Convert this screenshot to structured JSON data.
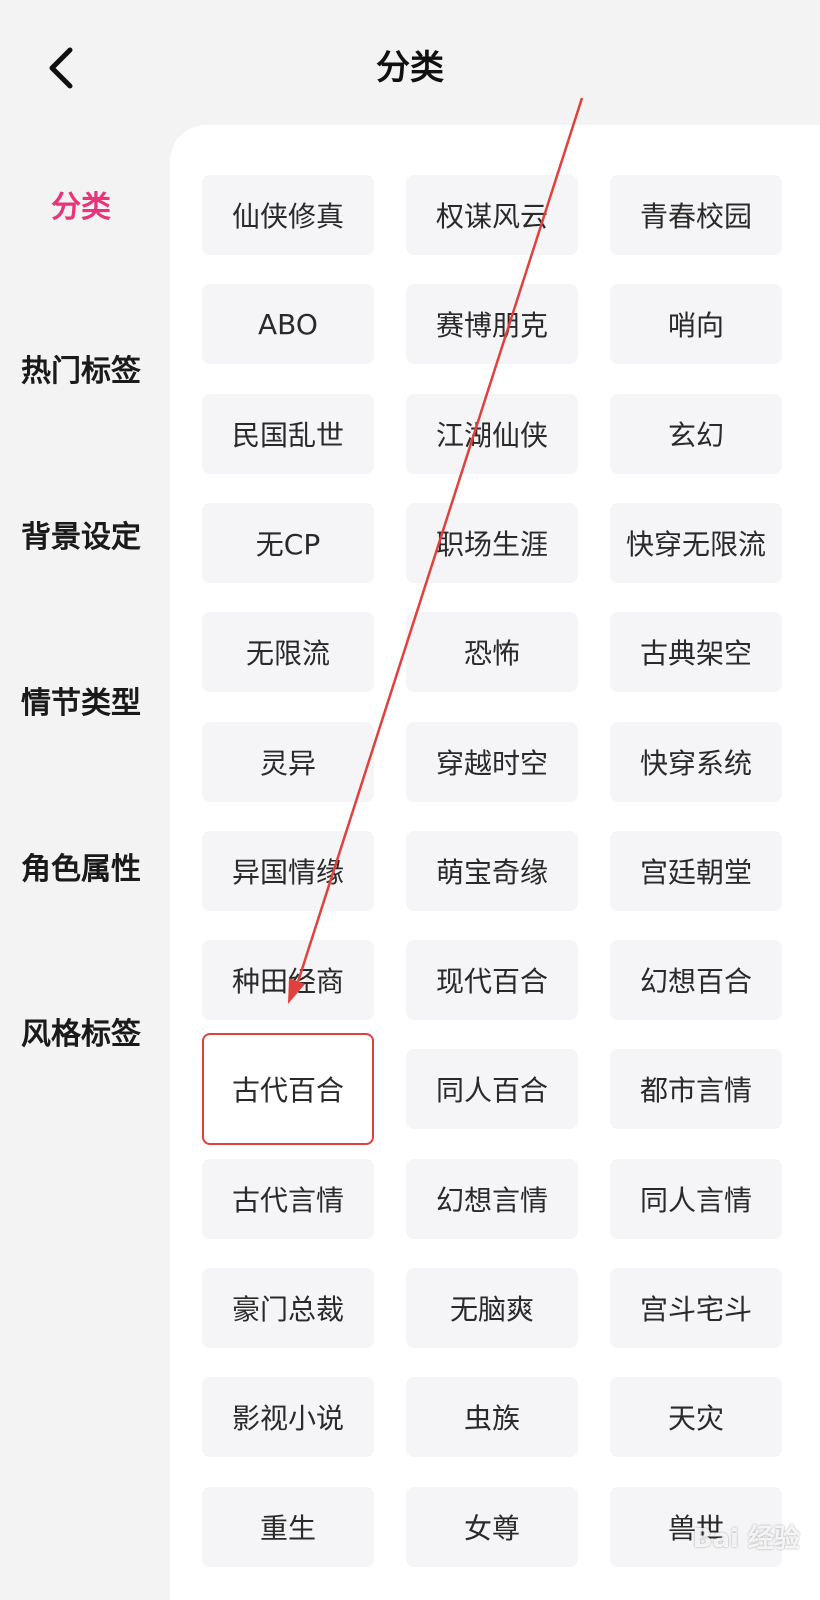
{
  "header": {
    "title": "分类",
    "back_icon": "chevron-left-icon"
  },
  "sidebar": {
    "items": [
      {
        "label": "分类",
        "active": true
      },
      {
        "label": "热门标签",
        "active": false
      },
      {
        "label": "背景设定",
        "active": false
      },
      {
        "label": "情节类型",
        "active": false
      },
      {
        "label": "角色属性",
        "active": false
      },
      {
        "label": "风格标签",
        "active": false
      }
    ],
    "active_color": "#e8347a"
  },
  "tags": [
    "仙侠修真",
    "权谋风云",
    "青春校园",
    "ABO",
    "赛博朋克",
    "哨向",
    "民国乱世",
    "江湖仙侠",
    "玄幻",
    "无CP",
    "职场生涯",
    "快穿无限流",
    "无限流",
    "恐怖",
    "古典架空",
    "灵异",
    "穿越时空",
    "快穿系统",
    "异国情缘",
    "萌宝奇缘",
    "宫廷朝堂",
    "种田经商",
    "现代百合",
    "幻想百合",
    "古代百合",
    "同人百合",
    "都市言情",
    "古代言情",
    "幻想言情",
    "同人言情",
    "豪门总裁",
    "无脑爽",
    "宫斗宅斗",
    "影视小说",
    "虫族",
    "天灾",
    "重生",
    "女尊",
    "兽世"
  ],
  "highlighted_tag": "古代百合",
  "annotation_color": "#e0413c",
  "watermark": "Bai 经验"
}
